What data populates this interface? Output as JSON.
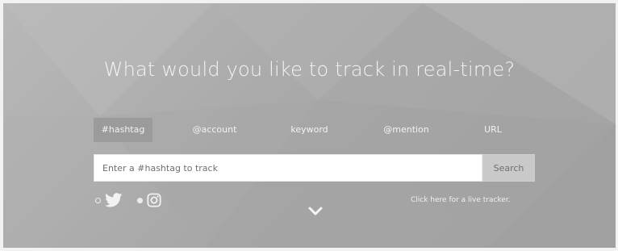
{
  "hero": {
    "headline": "What would you like to track in real-time?"
  },
  "tabs": [
    {
      "label": "#hashtag",
      "active": true
    },
    {
      "label": "@account",
      "active": false
    },
    {
      "label": "keyword",
      "active": false
    },
    {
      "label": "@mention",
      "active": false
    },
    {
      "label": "URL",
      "active": false
    }
  ],
  "search": {
    "placeholder": "Enter a #hashtag to track",
    "button_label": "Search"
  },
  "networks": [
    {
      "icon": "twitter-icon",
      "selected": false
    },
    {
      "icon": "instagram-icon",
      "selected": true
    }
  ],
  "footer": {
    "live_tracker_link": "Click here for a live tracker.",
    "scroll_icon": "chevron-down-icon"
  },
  "colors": {
    "background": "#a9a9a9",
    "active_tab": "#9b9b9b",
    "search_button": "#c9c9c9",
    "text_light": "#f4f4f4"
  }
}
